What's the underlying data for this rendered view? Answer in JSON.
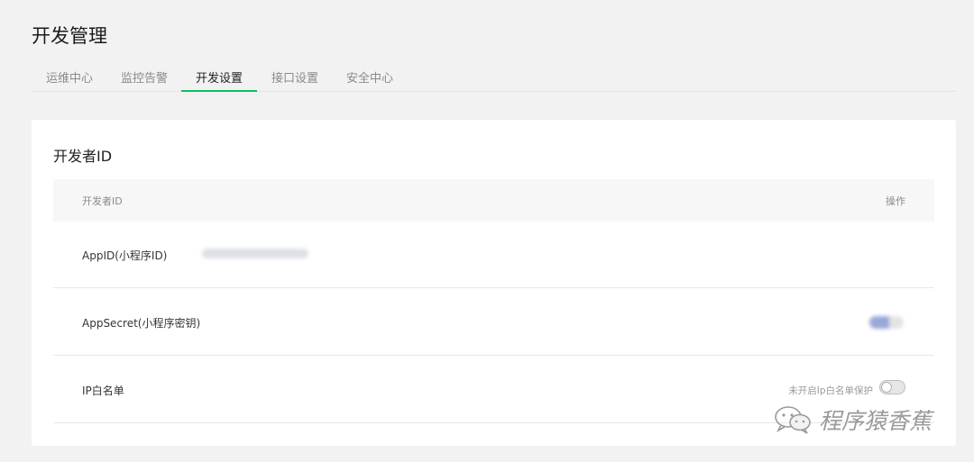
{
  "page": {
    "title": "开发管理"
  },
  "tabs": [
    {
      "label": "运维中心",
      "active": false
    },
    {
      "label": "监控告警",
      "active": false
    },
    {
      "label": "开发设置",
      "active": true
    },
    {
      "label": "接口设置",
      "active": false
    },
    {
      "label": "安全中心",
      "active": false
    }
  ],
  "developer_card": {
    "title": "开发者ID",
    "columns": {
      "id": "开发者ID",
      "action": "操作"
    },
    "rows": [
      {
        "label": "AppID(小程序ID)"
      },
      {
        "label": "AppSecret(小程序密钥)"
      },
      {
        "label": "IP白名单",
        "status": "未开启Ip白名单保护",
        "toggle_on": false
      }
    ]
  },
  "watermark": {
    "text": "程序猿香蕉",
    "icon": "wechat-icon"
  },
  "colors": {
    "accent": "#07c160",
    "background": "#f2f2f2",
    "card": "#ffffff"
  }
}
